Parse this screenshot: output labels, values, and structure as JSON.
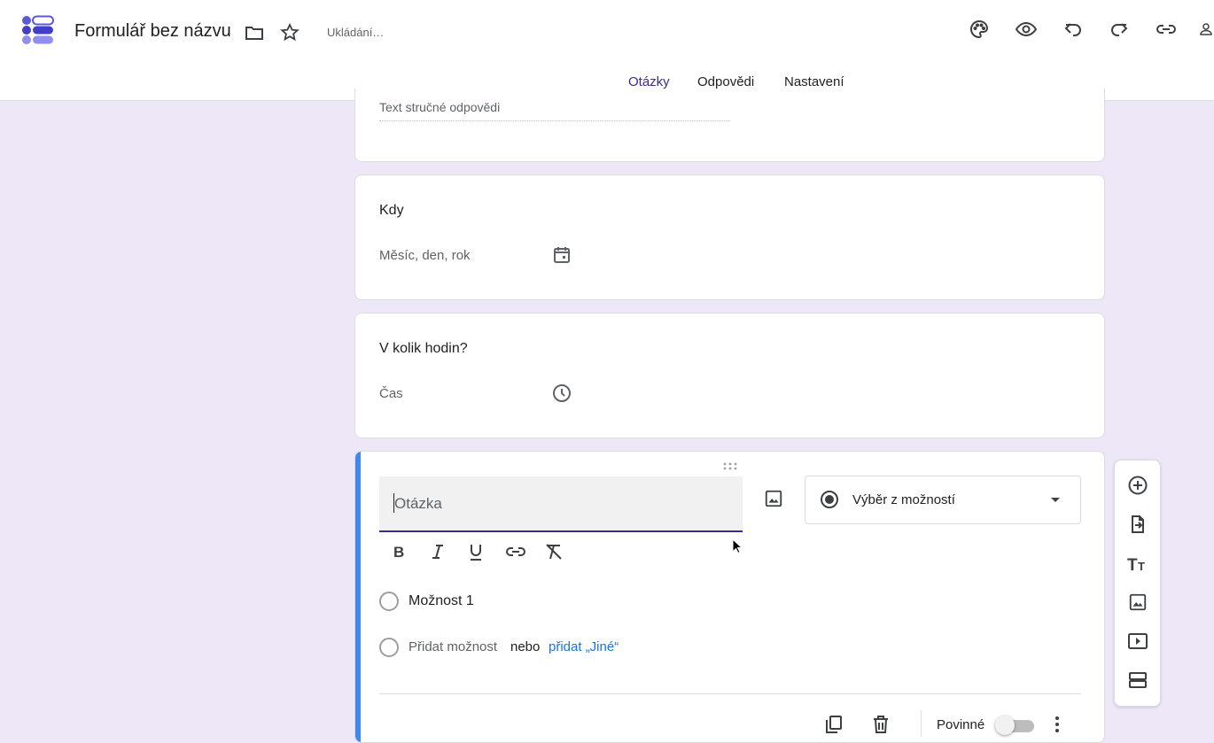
{
  "header": {
    "title": "Formulář bez názvu",
    "status": "Ukládání…",
    "colors": {
      "accent": "#3c2a8f",
      "logo": "#5b5bd6"
    },
    "icons": [
      "palette-icon",
      "eye-icon",
      "undo-icon",
      "redo-icon",
      "link-icon",
      "person-icon"
    ]
  },
  "tabs": [
    {
      "label": "Otázky",
      "active": true
    },
    {
      "label": "Odpovědi",
      "active": false
    },
    {
      "label": "Nastavení",
      "active": false
    }
  ],
  "cards": {
    "short_answer": {
      "hint": "Text stručné odpovědi"
    },
    "date": {
      "question": "Kdy",
      "hint": "Měsíc, den, rok"
    },
    "time": {
      "question": "V kolik hodin?",
      "hint": "Čas"
    },
    "editing": {
      "question_placeholder": "Otázka",
      "type_label": "Výběr z možností",
      "option1": "Možnost 1",
      "add_option": "Přidat možnost",
      "or": "nebo",
      "add_other": "přidat „Jiné“",
      "required_label": "Povinné",
      "required": false
    }
  }
}
